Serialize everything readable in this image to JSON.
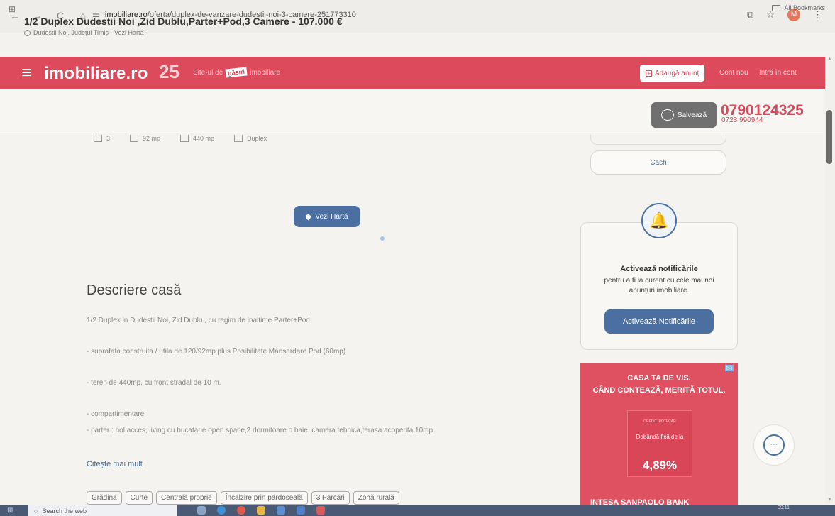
{
  "browser": {
    "url_host": "imobiliare.ro",
    "url_path": "/oferta/duplex-de-vanzare-dudestii-noi-3-camere-251773310",
    "all_bookmarks": "All Bookmarks",
    "profile_initial": "M",
    "back_glyph": "←",
    "forward_glyph": "→",
    "reload_glyph": "C",
    "home_glyph": "⌂",
    "tune_glyph": "⚌",
    "apps_glyph": "⊞",
    "share_glyph": "⧉",
    "star_glyph": "☆",
    "menu_glyph": "⋮"
  },
  "site_header": {
    "menu_glyph": "≡",
    "logo": "imobiliare.ro",
    "anniversary": "25",
    "tagline_prefix": "Site-ul de",
    "tagline_highlight": "găsiri",
    "tagline_suffix": "imobiliare",
    "add_listing": "Adaugă anunț",
    "add_glyph": "+",
    "new_account": "Cont nou",
    "sign_in": "Intră în cont"
  },
  "listing": {
    "title": "1/2 Duplex Dudestii Noi ,Zid Dublu,Parter+Pod,3 Camere - 107.000 €",
    "location": "Dudeștii Noi, Județul Timiș - Vezi Hartă",
    "save_label": "Salvează",
    "phone_primary": "0790124325",
    "phone_secondary": "0728 990944",
    "features": [
      "3",
      "92 mp",
      "440 mp",
      "Duplex"
    ]
  },
  "map": {
    "button_label": "Vezi Hartă"
  },
  "description": {
    "heading": "Descriere casă",
    "lines": [
      "1/2 Duplex in Dudestii Noi, Zid Dublu , cu regim de inaltime Parter+Pod",
      "- suprafata construita / utila de 120/92mp plus Posibilitate Mansardare Pod (60mp)",
      "- teren de 440mp, cu front stradal de 10 m.",
      "- compartimentare",
      "- parter : hol acces, living cu bucatarie open space,2 dormitoare o baie, camera tehnica,terasa acoperita 10mp"
    ],
    "read_more": "Citește mai mult"
  },
  "tags": [
    "Grădină",
    "Curte",
    "Centrală proprie",
    "Încălzire prin pardoseală",
    "3 Parcări",
    "Zonă rurală"
  ],
  "sidebar": {
    "cash_label": "Cash",
    "notif_title": "Activează notificările",
    "notif_text": "pentru a fi la curent cu cele mai noi anunțuri imobiliare.",
    "notif_button": "Activează Notificările",
    "bell_glyph": "🔔"
  },
  "ad": {
    "corner": "▷i",
    "line1": "CASA TA DE VIS.",
    "line2": "CÂND CONTEAZĂ, MERITĂ TOTUL.",
    "sub": "CREDIT IPOTECAR",
    "rate_label": "Dobândă fixă de la",
    "rate": "4,89%",
    "bank": "INTESA SANPAOLO BANK"
  },
  "chat": {
    "glyph": "···"
  },
  "taskbar": {
    "search_placeholder": "Search the web",
    "time": "09:11",
    "start_glyph": "⊞"
  },
  "colors": {
    "brand_red": "#dd4a5c",
    "accent_blue": "#4a6fa0",
    "phone_red": "#d9485c"
  }
}
